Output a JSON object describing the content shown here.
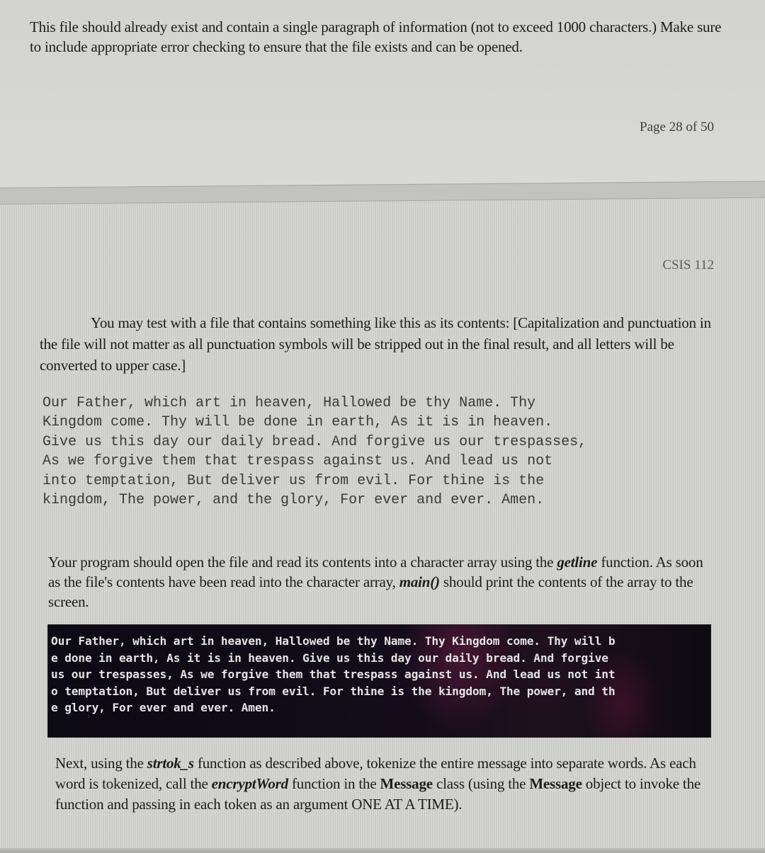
{
  "document": {
    "page_1": {
      "paragraph": "This file should already exist and contain a single paragraph of information (not to exceed 1000 characters.) Make sure to include appropriate error checking to ensure that the file exists and can be opened.",
      "page_number_label": "Page 28 of 50"
    },
    "page_2": {
      "course_header": "CSIS 112",
      "intro_paragraph": "You may test with a file that contains something like this as its contents: [Capitalization and punctuation in the file will not matter as all punctuation symbols will be stripped out in the final result, and all letters will be converted to upper case.]",
      "sample_file_lines": [
        "Our Father, which art in heaven, Hallowed be thy Name. Thy",
        "Kingdom come. Thy will be done in earth, As it is in heaven.",
        "Give us this day our daily bread. And forgive us our trespasses,",
        "As we forgive them that trespass against us. And lead us not",
        "into temptation, But deliver us from evil. For thine is the",
        "kingdom, The power, and the glory, For ever and ever. Amen."
      ],
      "read_paragraph": {
        "part_1": "Your program should open the file and read its contents into a character array using the ",
        "getline": "getline",
        "part_2": " function. As soon as the file's contents have been read into the character array, ",
        "main": "main()",
        "part_3": " should print the contents of the array to the screen."
      },
      "console_output_lines": [
        "Our Father, which art in heaven, Hallowed be thy Name. Thy Kingdom come. Thy will b",
        "e done in earth, As it is in heaven. Give us this day our daily bread. And forgive",
        "us our trespasses, As we forgive them that trespass against us. And lead us not int",
        "o temptation, But deliver us from evil. For thine is the kingdom, The power, and th",
        "e glory, For ever and ever. Amen."
      ],
      "tokenize_paragraph": {
        "part_1": "Next, using the ",
        "strtok": "strtok_s",
        "part_2": " function as described above, tokenize the entire message into separate words.  As each word is tokenized, call the ",
        "encrypt": "encryptWord",
        "part_3": " function in the ",
        "message_1": "Message",
        "part_4": " class (using the ",
        "message_2": "Message",
        "part_5": " object to invoke the function and passing in each token as an argument ONE AT A TIME)."
      }
    }
  },
  "colors": {
    "page_background": "#d4d4d0",
    "text": "#1c1c1c",
    "console_background": "#0c0a14",
    "console_text": "#e4e4e4"
  }
}
